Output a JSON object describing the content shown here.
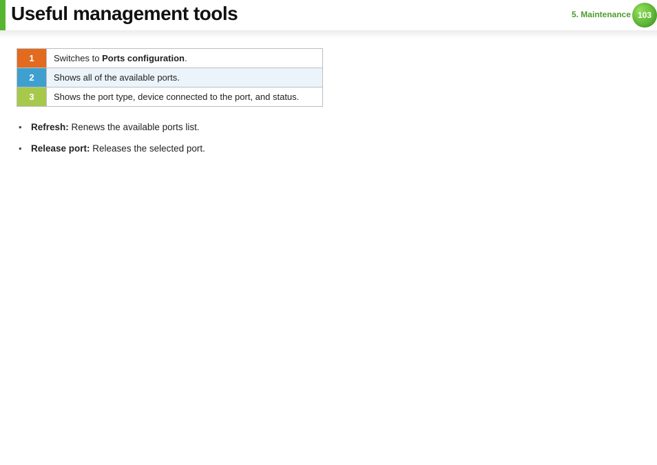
{
  "header": {
    "title": "Useful management tools",
    "chapter": "5.  Maintenance",
    "page_number": "103"
  },
  "table": {
    "rows": [
      {
        "num": "1",
        "prefix": "Switches to ",
        "strong": "Ports configuration",
        "suffix": "."
      },
      {
        "num": "2",
        "prefix": "Shows all of the available ports.",
        "strong": "",
        "suffix": ""
      },
      {
        "num": "3",
        "prefix": "Shows the port type, device connected to the port, and status.",
        "strong": "",
        "suffix": ""
      }
    ]
  },
  "bullets": [
    {
      "lead": "Refresh:",
      "rest": " Renews the available ports list."
    },
    {
      "lead": "Release port:",
      "rest": " Releases the selected port."
    }
  ]
}
